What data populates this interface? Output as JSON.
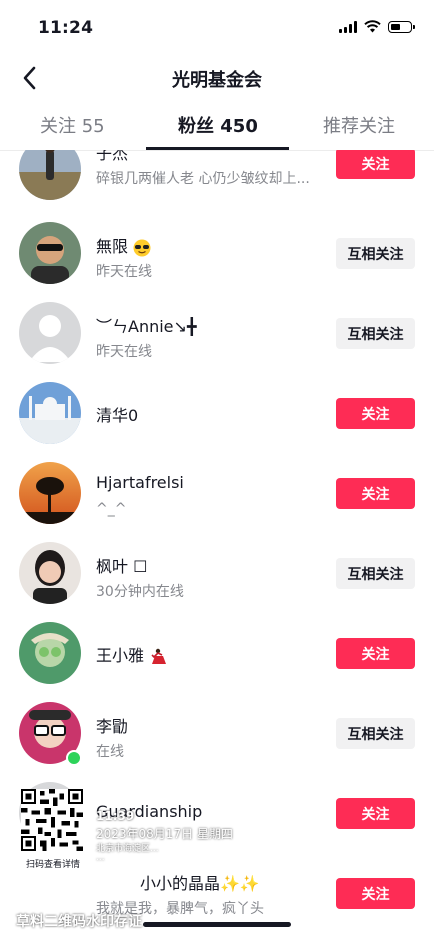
{
  "status": {
    "time": "11:24"
  },
  "nav": {
    "title": "光明基金会",
    "back_icon": "chevron-left-icon"
  },
  "tabs": [
    {
      "label": "关注 55",
      "active": false
    },
    {
      "label": "粉丝 450",
      "active": true
    },
    {
      "label": "推荐关注",
      "active": false
    }
  ],
  "rows": [
    {
      "name": "子杰",
      "sub": "碎银几两催人老 心仍少皱纹却上...",
      "button": "关注",
      "button_type": "follow",
      "online": false
    },
    {
      "name": "無限",
      "name_emoji": "sunglasses-emoji",
      "sub": "昨天在线",
      "button": "互相关注",
      "button_type": "mutual",
      "online": false
    },
    {
      "name": "︶ㄣAnnie↘╋",
      "sub": "昨天在线",
      "button": "互相关注",
      "button_type": "mutual",
      "online": false
    },
    {
      "name": "清华0",
      "sub": "",
      "button": "关注",
      "button_type": "follow",
      "online": false
    },
    {
      "name": "Hjartafrelsi",
      "sub": "^_^",
      "button": "关注",
      "button_type": "follow",
      "online": false
    },
    {
      "name": "枫叶 ☐",
      "sub": "30分钟内在线",
      "button": "互相关注",
      "button_type": "mutual",
      "online": false
    },
    {
      "name": "王小雅",
      "name_emoji": "dancer-emoji",
      "sub": "",
      "button": "关注",
      "button_type": "follow",
      "online": false
    },
    {
      "name": "李勖",
      "sub": "在线",
      "button": "互相关注",
      "button_type": "mutual",
      "online": true
    },
    {
      "name": "Guardianship",
      "sub": "",
      "button": "关注",
      "button_type": "follow",
      "online": false
    },
    {
      "name": "小小的晶晶✨✨",
      "sub": "我就是我，暴脾气，疯丫头",
      "button": "关注",
      "button_type": "follow",
      "online": false
    }
  ],
  "watermark": {
    "qr_caption": "扫码查看详情",
    "time": "11:39",
    "date": "2023年08月17日 星期四",
    "location_line1": "北京市海淀区...",
    "location_line2": "...",
    "bottom_text": "草料二维码水印存证"
  },
  "colors": {
    "accent": "#fe2c55",
    "mutual_bg": "#f1f1f2",
    "online": "#2dd35a"
  }
}
